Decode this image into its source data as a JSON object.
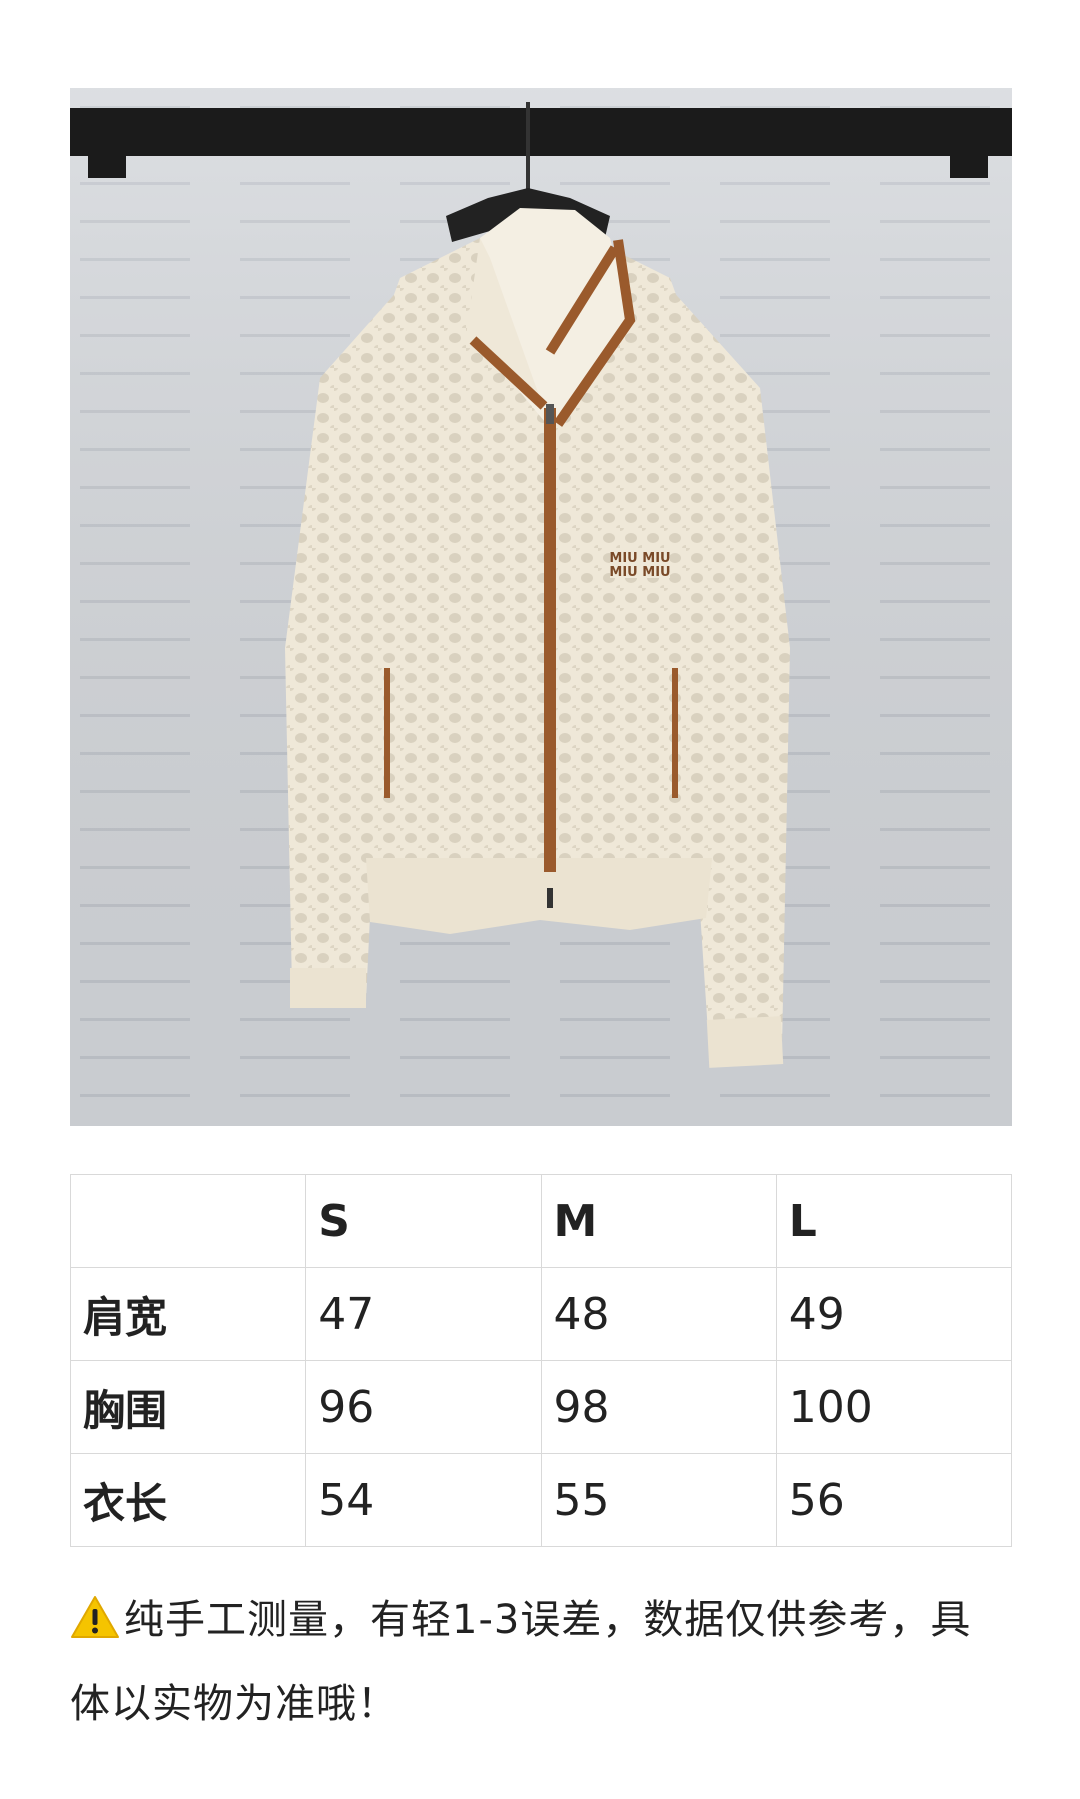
{
  "size_table": {
    "header": [
      "",
      "S",
      "M",
      "L"
    ],
    "rows": [
      {
        "label": "肩宽",
        "values": [
          "47",
          "48",
          "49"
        ]
      },
      {
        "label": "胸围",
        "values": [
          "96",
          "98",
          "100"
        ]
      },
      {
        "label": "衣长",
        "values": [
          "54",
          "55",
          "56"
        ]
      }
    ]
  },
  "note": {
    "icon": "warning-icon",
    "text": "纯手工测量，有轻1-3误差，数据仅供参考，具体以实物为准哦！"
  },
  "photo": {
    "logo_text": "MIU MIU",
    "colors": {
      "wall": "#d6d9dd",
      "rail": "#1b1b1b",
      "knit": "#efe8d8",
      "trim": "#9a5a2c"
    }
  }
}
